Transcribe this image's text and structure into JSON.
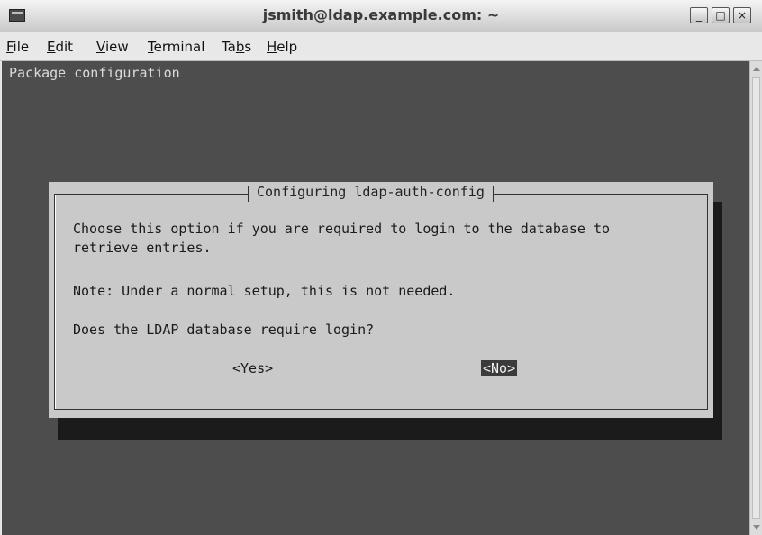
{
  "window": {
    "title": "jsmith@ldap.example.com: ~",
    "controls": {
      "minimize": "_",
      "maximize": "□",
      "close": "×"
    }
  },
  "menu": {
    "items": [
      {
        "prefix": "",
        "accel": "F",
        "rest": "ile"
      },
      {
        "prefix": "",
        "accel": "E",
        "rest": "dit"
      },
      {
        "prefix": "",
        "accel": "V",
        "rest": "iew"
      },
      {
        "prefix": "",
        "accel": "T",
        "rest": "erminal"
      },
      {
        "prefix": "Ta",
        "accel": "b",
        "rest": "s"
      },
      {
        "prefix": "",
        "accel": "H",
        "rest": "elp"
      }
    ]
  },
  "terminal": {
    "header": "Package configuration"
  },
  "dialog": {
    "title": "Configuring ldap-auth-config",
    "line1": "Choose this option if you are required to login to the database to",
    "line2": "retrieve entries.",
    "note": "Note: Under a normal setup, this is not needed.",
    "question": "Does the LDAP database require login?",
    "yes_label": "<Yes>",
    "no_label": "<No>"
  },
  "colors": {
    "terminal_bg": "#4d4d4d",
    "dialog_bg": "#c9c9c9",
    "selected_button_bg": "#3b3b3b"
  }
}
